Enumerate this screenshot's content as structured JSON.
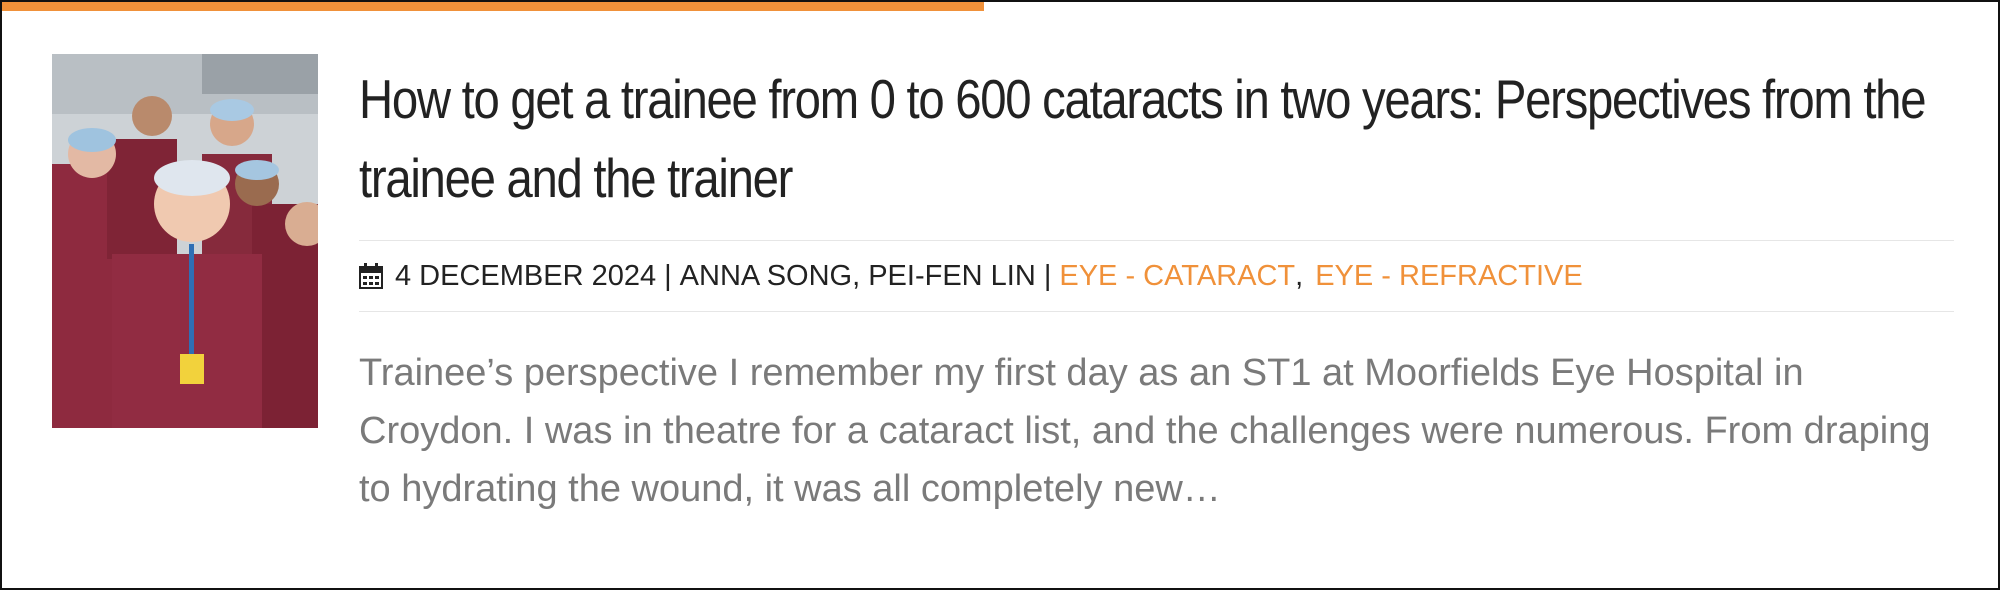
{
  "post": {
    "title": "How to get a trainee from 0 to 600 cataracts in two years: Perspectives from the trainee and the trainer",
    "date": "4 DECEMBER 2024",
    "authors": "ANNA SONG, PEI-FEN LIN",
    "categories": [
      "EYE - CATARACT",
      "EYE - REFRACTIVE"
    ],
    "category_separator": ",",
    "meta_separator": "|",
    "excerpt": "Trainee’s perspective I remember my first day as an ST1 at Moorfields Eye Hospital in Croydon. I was in theatre for a cataract list, and the challenges were numerous. From draping to hydrating the wound, it was all completely new…"
  },
  "colors": {
    "accent": "#f0913a",
    "title": "#222222",
    "excerpt": "#7a7a7a"
  },
  "icons": {
    "date": "calendar-icon"
  }
}
